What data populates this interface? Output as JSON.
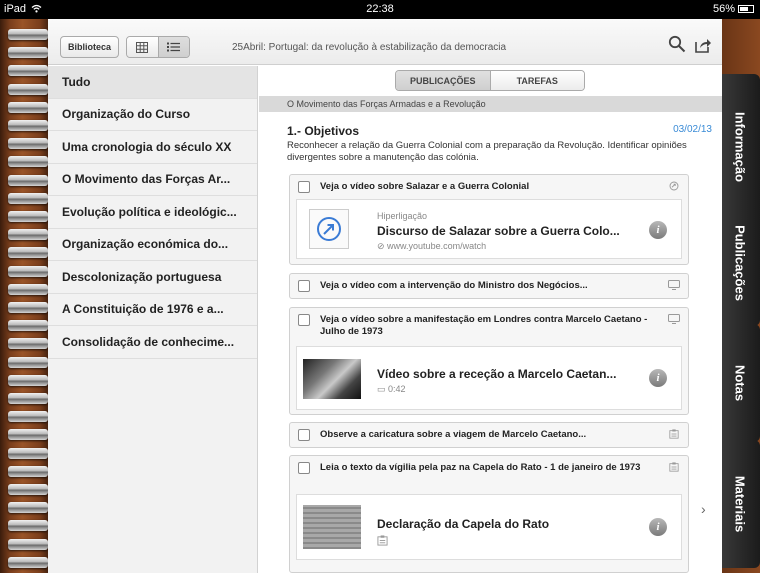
{
  "status_bar": {
    "device": "iPad",
    "time": "22:38",
    "battery_percent": "56%",
    "battery_level": 0.56
  },
  "toolbar": {
    "library_label": "Biblioteca",
    "title": "25Abril: Portugal: da revolução à estabilização da democracia"
  },
  "sidebar": {
    "items": [
      {
        "label": "Tudo"
      },
      {
        "label": "Organização do Curso"
      },
      {
        "label": "Uma cronologia do século XX"
      },
      {
        "label": "O Movimento das Forças Ar..."
      },
      {
        "label": "Evolução política e ideológic..."
      },
      {
        "label": "Organização económica do..."
      },
      {
        "label": "Descolonização portuguesa"
      },
      {
        "label": "A Constituição de 1976 e a..."
      },
      {
        "label": "Consolidação de conhecime..."
      }
    ]
  },
  "content": {
    "tabs": {
      "publicacoes": "PUBLICAÇÕES",
      "tarefas": "TAREFAS"
    },
    "section": "O Movimento das Forças Armadas e a Revolução",
    "objective": {
      "title": "1.- Objetivos",
      "date": "03/02/13",
      "description": "Reconhecer a relação da Guerra Colonial com a preparação da Revolução. Identificar opiniões divergentes sobre a manutenção das colónia."
    },
    "tasks": [
      {
        "label": "Veja o vídeo sobre Salazar e a Guerra Colonial",
        "icon": "link-icon",
        "card": {
          "kicker": "Hiperligação",
          "title": "Discurso de Salazar sobre a Guerra Colo...",
          "sub": "www.youtube.com/watch"
        }
      },
      {
        "label": "Veja o vídeo com a intervenção do Ministro dos Negócios...",
        "icon": "video-icon"
      },
      {
        "label": "Veja o vídeo sobre a manifestação em Londres contra Marcelo Caetano - Julho de 1973",
        "icon": "video-icon",
        "card": {
          "title": "Vídeo sobre a receção a Marcelo Caetan...",
          "sub": "0:42"
        }
      },
      {
        "label": "Observe a caricatura sobre a viagem de Marcelo Caetano...",
        "icon": "document-icon"
      },
      {
        "label": "Leia o texto da vígilia pela paz na Capela do Rato - 1 de janeiro de 1973",
        "icon": "document-icon",
        "card": {
          "title": "Declaração da Capela do Rato"
        }
      }
    ]
  },
  "right_tabs": [
    "Informação",
    "Publicações",
    "Notas",
    "Materiais"
  ]
}
